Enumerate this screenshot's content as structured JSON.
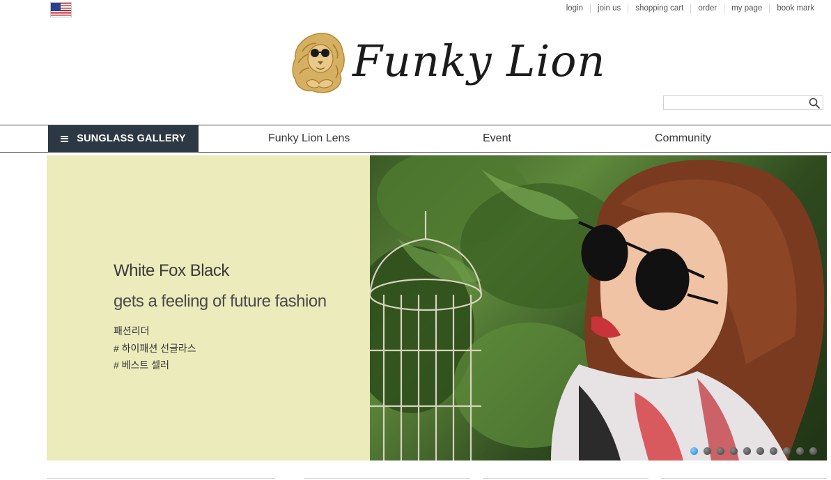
{
  "header": {
    "flag_icon": "us-flag-icon",
    "top_links": [
      {
        "label": "login"
      },
      {
        "label": "join us"
      },
      {
        "label": "shopping cart"
      },
      {
        "label": "order"
      },
      {
        "label": "my page"
      },
      {
        "label": "book mark"
      }
    ],
    "logo_text": "Funky Lion",
    "search": {
      "value": "",
      "placeholder": "",
      "icon": "search-icon"
    }
  },
  "nav": {
    "gallery_label": "SUNGLASS GALLERY",
    "items": [
      {
        "label": "Funky Lion Lens"
      },
      {
        "label": "Event"
      },
      {
        "label": "Community"
      }
    ]
  },
  "banner": {
    "title": "White Fox Black",
    "subtitle": "gets a feeling of future fashion",
    "tags": [
      "패션리더",
      "# 하이패션 선글라스",
      "# 베스트 셀러"
    ],
    "background_color": "#ecebbc",
    "slide_count": 10,
    "active_slide": 1
  },
  "colors": {
    "nav_dark": "#2c3843",
    "logo_gold": "#c9a14a",
    "dot_active": "#1a7ecb"
  }
}
